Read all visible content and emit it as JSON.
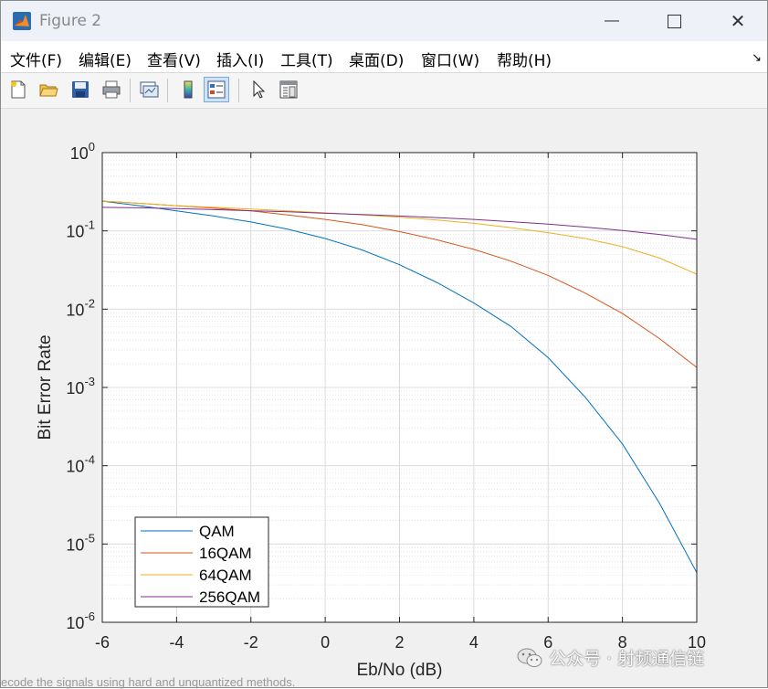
{
  "window": {
    "title": "Figure 2",
    "minimize_glyph": "—",
    "close_glyph": "✕"
  },
  "menu": {
    "items": [
      "文件(F)",
      "编辑(E)",
      "查看(V)",
      "插入(I)",
      "工具(T)",
      "桌面(D)",
      "窗口(W)",
      "帮助(H)"
    ],
    "overflow_glyph": "↘"
  },
  "toolbar": {
    "icons": [
      "new-figure-icon",
      "open-file-icon",
      "save-icon",
      "print-icon",
      "link-plot-icon",
      "colorbar-icon",
      "legend-icon",
      "pointer-icon",
      "property-inspector-icon"
    ],
    "active": "legend-icon"
  },
  "chart_data": {
    "type": "line",
    "title": "",
    "xlabel": "Eb/No (dB)",
    "ylabel": "Bit Error Rate",
    "xlim": [
      -6,
      10
    ],
    "ylim": [
      1e-06,
      1
    ],
    "yscale": "log",
    "grid": true,
    "xticks": [
      -6,
      -4,
      -2,
      0,
      2,
      4,
      6,
      8,
      10
    ],
    "xtick_labels": [
      "-6",
      "-4",
      "-2",
      "0",
      "2",
      "4",
      "6",
      "8",
      "10"
    ],
    "yticks": [
      {
        "base": "10",
        "exp": "0"
      },
      {
        "base": "10",
        "exp": "-1"
      },
      {
        "base": "10",
        "exp": "-2"
      },
      {
        "base": "10",
        "exp": "-3"
      },
      {
        "base": "10",
        "exp": "-4"
      },
      {
        "base": "10",
        "exp": "-5"
      },
      {
        "base": "10",
        "exp": "-6"
      }
    ],
    "legend_position": "bottom-left",
    "x": [
      -6,
      -5,
      -4,
      -3,
      -2,
      -1,
      0,
      1,
      2,
      3,
      4,
      5,
      6,
      7,
      8,
      9,
      10
    ],
    "series": [
      {
        "name": "QAM",
        "color": "#0072bd",
        "values": [
          0.24,
          0.21,
          0.18,
          0.155,
          0.13,
          0.105,
          0.08,
          0.057,
          0.037,
          0.022,
          0.012,
          0.006,
          0.0024,
          0.00075,
          0.00019,
          3.3e-05,
          4.3e-06
        ]
      },
      {
        "name": "16QAM",
        "color": "#d95319",
        "values": [
          0.24,
          0.225,
          0.21,
          0.195,
          0.18,
          0.16,
          0.14,
          0.12,
          0.098,
          0.077,
          0.058,
          0.041,
          0.027,
          0.016,
          0.0088,
          0.0042,
          0.0018
        ]
      },
      {
        "name": "64QAM",
        "color": "#edb120",
        "values": [
          0.24,
          0.225,
          0.21,
          0.2,
          0.19,
          0.18,
          0.17,
          0.16,
          0.15,
          0.138,
          0.125,
          0.11,
          0.095,
          0.08,
          0.063,
          0.045,
          0.028
        ]
      },
      {
        "name": "256QAM",
        "color": "#7e2f8e",
        "values": [
          0.2,
          0.197,
          0.193,
          0.187,
          0.181,
          0.175,
          0.168,
          0.162,
          0.155,
          0.148,
          0.14,
          0.131,
          0.122,
          0.112,
          0.101,
          0.09,
          0.078
        ]
      }
    ]
  },
  "watermark": {
    "text": "公众号 · 射频通信链"
  },
  "background_text": "ecode the signals using hard and unquantized methods."
}
